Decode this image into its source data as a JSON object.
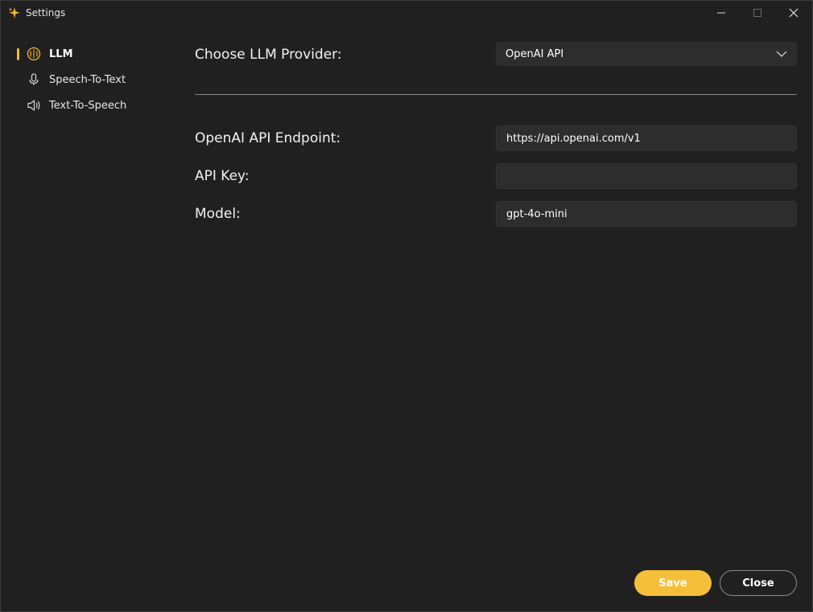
{
  "window": {
    "title": "Settings",
    "icon": "sparkle-icon",
    "accent": "#f5b82e"
  },
  "sidebar": {
    "items": [
      {
        "label": "LLM",
        "icon": "brain-icon",
        "active": true
      },
      {
        "label": "Speech-To-Text",
        "icon": "microphone-icon",
        "active": false
      },
      {
        "label": "Text-To-Speech",
        "icon": "speaker-icon",
        "active": false
      }
    ]
  },
  "main": {
    "provider": {
      "label": "Choose LLM Provider:",
      "selected": "OpenAI API"
    },
    "fields": [
      {
        "label": "OpenAI API Endpoint:",
        "value": "https://api.openai.com/v1"
      },
      {
        "label": "API Key:",
        "value": ""
      },
      {
        "label": "Model:",
        "value": "gpt-4o-mini"
      }
    ]
  },
  "footer": {
    "save_label": "Save",
    "close_label": "Close"
  }
}
